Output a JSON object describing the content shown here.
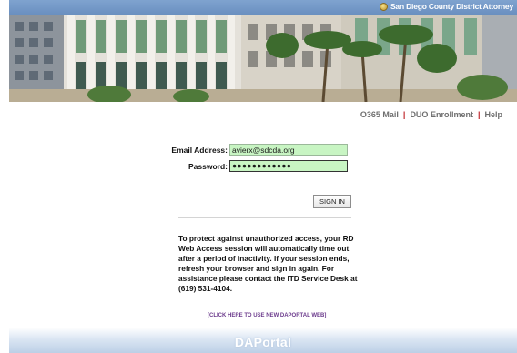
{
  "header": {
    "title": "San Diego County District Attorney",
    "seal_icon": "county-seal-icon"
  },
  "top_links": [
    {
      "label": "O365 Mail"
    },
    {
      "label": "DUO Enrollment"
    },
    {
      "label": "Help"
    }
  ],
  "form": {
    "email_label": "Email Address:",
    "email_value": "avierx@sdcda.org",
    "password_label": "Password:",
    "password_value": "●●●●●●●●●●●●",
    "signin_label": "SIGN IN"
  },
  "notice": "To protect against unauthorized access, your RD Web Access session will automatically time out after a period of inactivity. If your session ends, refresh your browser and sign in again. For assistance please contact the ITD Service Desk at (619) 531-4104.",
  "new_portal_link": "[CLICK HERE TO USE NEW DAPORTAL WEB]",
  "footer": {
    "brand": "DAPortal"
  },
  "colors": {
    "banner": "#7fa3cf",
    "separator": "#c0282d",
    "field_bg": "#c8f5c3",
    "link_purple": "#6b3a8c"
  }
}
